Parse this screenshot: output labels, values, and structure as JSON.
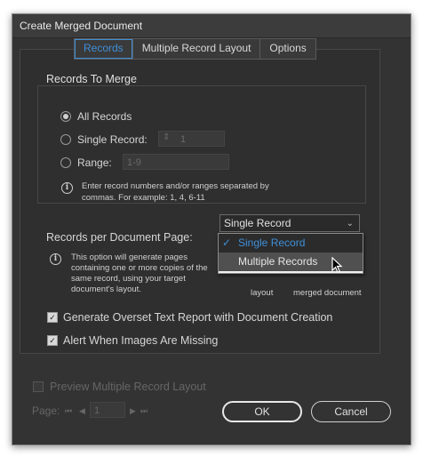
{
  "window": {
    "title": "Create Merged Document"
  },
  "tabs": [
    {
      "label": "Records",
      "active": true
    },
    {
      "label": "Multiple Record Layout",
      "active": false
    },
    {
      "label": "Options",
      "active": false
    }
  ],
  "records_to_merge": {
    "title": "Records To Merge",
    "all_records_label": "All Records",
    "single_record_label": "Single Record:",
    "single_record_value": "1",
    "range_label": "Range:",
    "range_value": "1-9",
    "info_line1": "Enter record numbers and/or ranges separated by",
    "info_line2": "commas. For example: 1, 4, 6-11"
  },
  "records_per_page": {
    "label": "Records per Document Page:",
    "selected": "Single Record",
    "options": [
      "Single Record",
      "Multiple Records"
    ],
    "info_lines": [
      "This option will generate pages",
      "containing one or more copies of the",
      "same record, using your target",
      "document's layout."
    ],
    "partial_text_left": "layout",
    "partial_text_right": "merged document"
  },
  "options": {
    "overset_label": "Generate Overset Text Report with Document Creation",
    "overset_checked": true,
    "alert_label": "Alert When Images Are Missing",
    "alert_checked": true
  },
  "preview": {
    "label": "Preview Multiple Record Layout",
    "checked": false
  },
  "pager": {
    "label": "Page:",
    "value": "1"
  },
  "buttons": {
    "ok": "OK",
    "cancel": "Cancel"
  },
  "icons": {
    "check": "✓",
    "caret": "chevron-down-icon",
    "first": "⏮",
    "prev": "◀",
    "next": "▶",
    "last": "⏭"
  },
  "colors": {
    "accent": "#3f8fd8",
    "dialog_bg": "#333333"
  }
}
